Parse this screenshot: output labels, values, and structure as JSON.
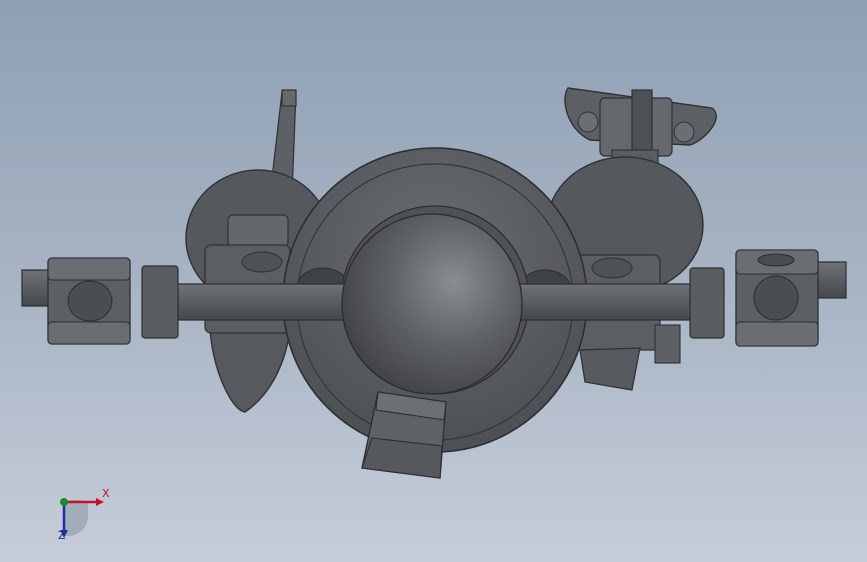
{
  "viewport": {
    "background_top": "#8f9fb4",
    "background_bottom": "#c6cdd8",
    "part_color": "#5a5d62"
  },
  "triad": {
    "x_label": "X",
    "z_label": "Z",
    "y_label": "",
    "x_color": "#c8102e",
    "y_color": "#1c8a2a",
    "z_color": "#1a2fa8"
  }
}
